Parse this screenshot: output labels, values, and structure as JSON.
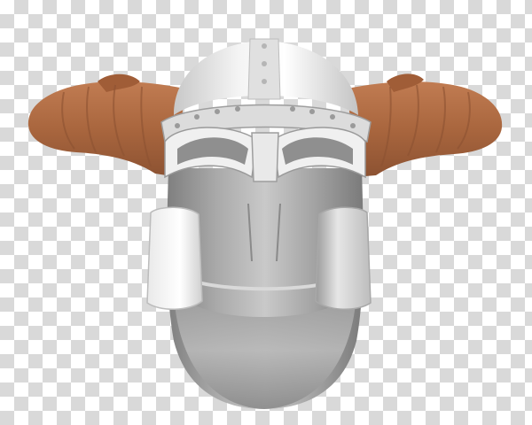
{
  "image": {
    "subject_icon": "horned-viking-helmet-icon",
    "background": "transparency-checkerboard",
    "colors": {
      "checker_light": "#ffffff",
      "checker_dark": "#d9d9d9",
      "horn_base": "#b06d44",
      "horn_shadow": "#8c5232",
      "steel_light": "#f2f2f2",
      "steel_mid": "#bdbdbd",
      "steel_dark": "#7a7a7a"
    }
  }
}
